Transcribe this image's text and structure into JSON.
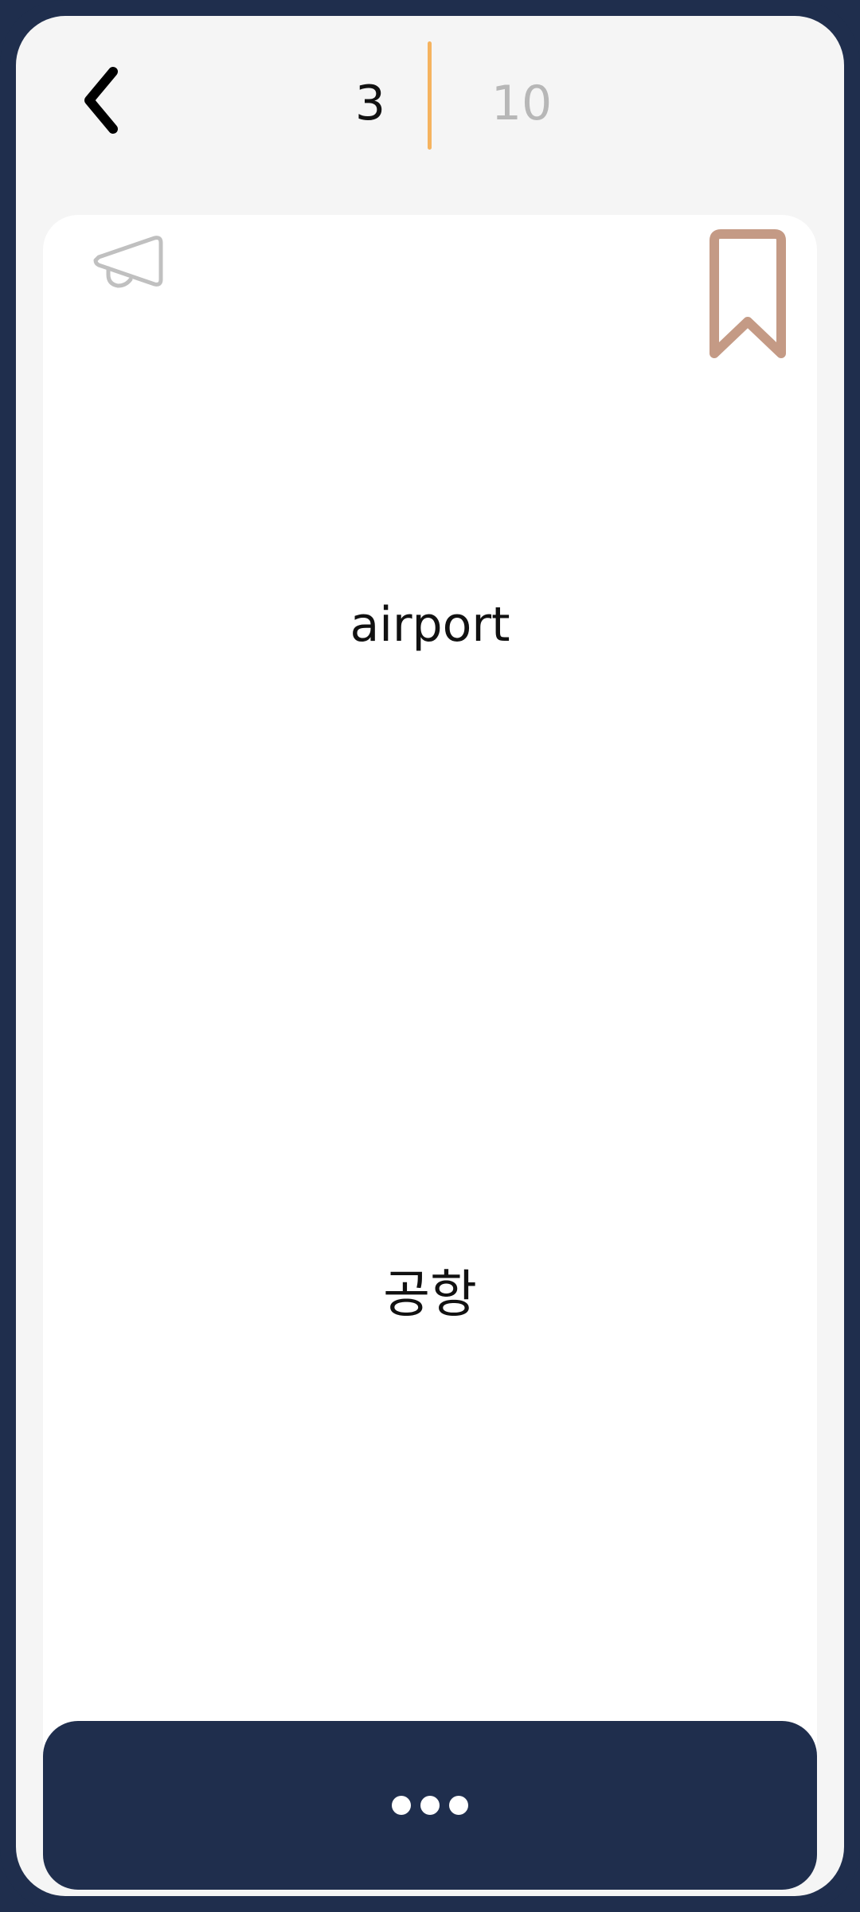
{
  "header": {
    "current_index": "3",
    "total_count": "10",
    "accent_color": "#f5b35f",
    "back_icon": "chevron-left-icon"
  },
  "card": {
    "word": "airport",
    "translation": "공항",
    "sound_icon": "megaphone-icon",
    "bookmark_icon": "bookmark-icon",
    "bookmark_color": "#c49a85"
  },
  "footer": {
    "more_icon": "more-dots-icon",
    "background_color": "#1f2e4d"
  }
}
